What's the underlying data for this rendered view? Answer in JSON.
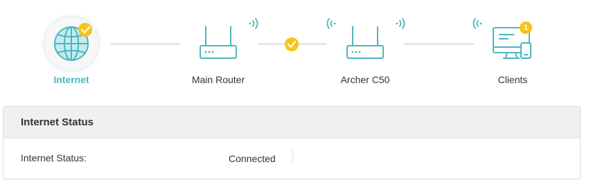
{
  "topology": {
    "nodes": [
      {
        "id": "internet",
        "label": "Internet",
        "icon": "globe-icon",
        "active": true,
        "status": "connected"
      },
      {
        "id": "main-router",
        "label": "Main Router",
        "icon": "router-icon",
        "active": false
      },
      {
        "id": "archer",
        "label": "Archer C50",
        "icon": "router-icon",
        "active": false
      },
      {
        "id": "clients",
        "label": "Clients",
        "icon": "monitor-phone-icon",
        "active": false,
        "badge": "1"
      }
    ],
    "link_status": "connected"
  },
  "colors": {
    "accent": "#4ab5c0",
    "badge": "#f5c518",
    "line": "#bfbfbf",
    "panel_header": "#f0f0f0"
  },
  "panel": {
    "title": "Internet Status",
    "rows": [
      {
        "label": "Internet Status:",
        "value": "Connected"
      }
    ]
  }
}
